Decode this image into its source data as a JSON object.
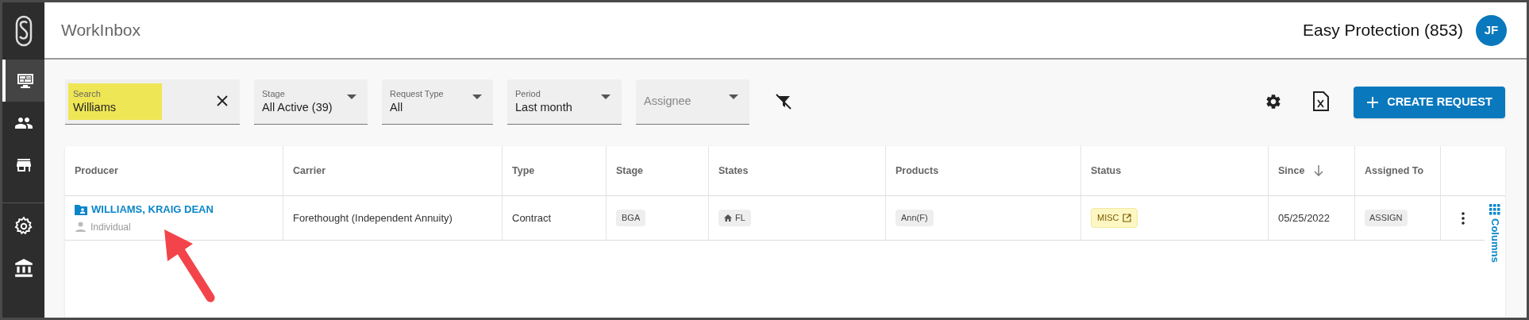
{
  "header": {
    "title": "WorkInbox",
    "organization": "Easy Protection (853)",
    "avatar": "JF"
  },
  "sidebar": {
    "items": [
      {
        "kind": "monitor",
        "selected": true
      },
      {
        "kind": "people",
        "selected": false
      },
      {
        "kind": "store",
        "selected": false
      },
      {
        "kind": "gear",
        "selected": false
      },
      {
        "kind": "bank",
        "selected": false
      }
    ]
  },
  "filters": [
    {
      "kind": "search",
      "label": "Search",
      "value": "Williams",
      "highlighted": true
    },
    {
      "kind": "select",
      "label": "Stage",
      "value": "All Active (39)"
    },
    {
      "kind": "select",
      "label": "Request Type",
      "value": "All"
    },
    {
      "kind": "select",
      "label": "Period",
      "value": "Last month"
    },
    {
      "kind": "select",
      "placeholder": "Assignee"
    }
  ],
  "create_button": "CREATE REQUEST",
  "table": {
    "columns": [
      {
        "label": "Producer",
        "sorted": false
      },
      {
        "label": "Carrier",
        "sorted": false
      },
      {
        "label": "Type",
        "sorted": false
      },
      {
        "label": "Stage",
        "sorted": false
      },
      {
        "label": "States",
        "sorted": false
      },
      {
        "label": "Products",
        "sorted": false
      },
      {
        "label": "Status",
        "sorted": false
      },
      {
        "label": "Since",
        "sorted": true
      },
      {
        "label": "Assigned To",
        "sorted": false
      }
    ],
    "rows": [
      {
        "producer": "WILLIAMS, KRAIG DEAN",
        "producer_type": "Individual",
        "carrier": "Forethought (Independent Annuity)",
        "type": "Contract",
        "stage": "BGA",
        "states": "FL",
        "products": "Ann(F)",
        "status": "MISC",
        "since": "05/25/2022",
        "assigned_to": "ASSIGN"
      }
    ],
    "columns_tab": "Columns"
  }
}
